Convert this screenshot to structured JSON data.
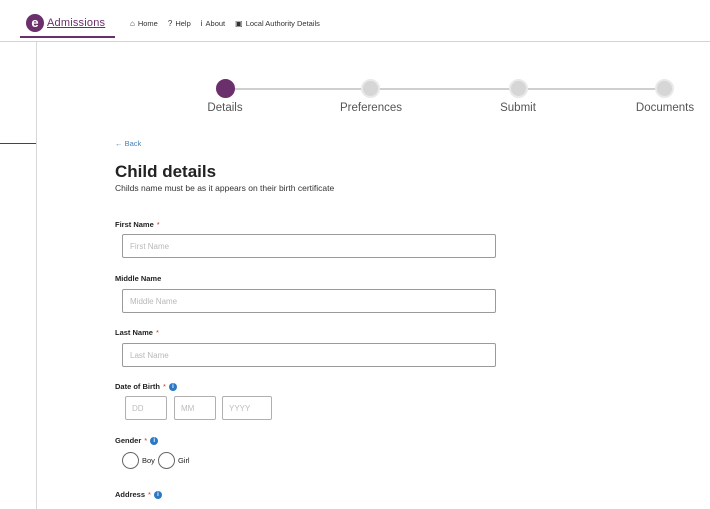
{
  "brand": {
    "logo_letter": "e",
    "name": "Admissions"
  },
  "nav": [
    {
      "icon": "home-icon",
      "glyph": "⌂",
      "label": "Home"
    },
    {
      "icon": "help-icon",
      "glyph": "?",
      "label": "Help"
    },
    {
      "icon": "info-icon",
      "glyph": "i",
      "label": "About"
    },
    {
      "icon": "building-icon",
      "glyph": "▣",
      "label": "Local Authority Details"
    }
  ],
  "stepper": [
    {
      "label": "Details",
      "active": true
    },
    {
      "label": "Preferences",
      "active": false
    },
    {
      "label": "Submit",
      "active": false
    },
    {
      "label": "Documents",
      "active": false
    }
  ],
  "form": {
    "back_label": "← Back",
    "title": "Child details",
    "subtitle": "Childs name must be as it appears on their birth certificate",
    "first_name": {
      "label": "First Name",
      "required_mark": "*",
      "placeholder": "First Name",
      "value": ""
    },
    "middle_name": {
      "label": "Middle Name",
      "placeholder": "Middle Name",
      "value": ""
    },
    "last_name": {
      "label": "Last Name",
      "required_mark": "*",
      "placeholder": "Last Name",
      "value": ""
    },
    "dob": {
      "label": "Date of Birth",
      "required_mark": "*",
      "day_placeholder": "DD",
      "month_placeholder": "MM",
      "year_placeholder": "YYYY"
    },
    "gender": {
      "label": "Gender",
      "required_mark": "*",
      "options": [
        "Boy",
        "Girl"
      ]
    },
    "address": {
      "label": "Address",
      "required_mark": "*"
    }
  },
  "colors": {
    "brand": "#6b2f6b",
    "info": "#2b78c5",
    "required": "#c0392b"
  }
}
